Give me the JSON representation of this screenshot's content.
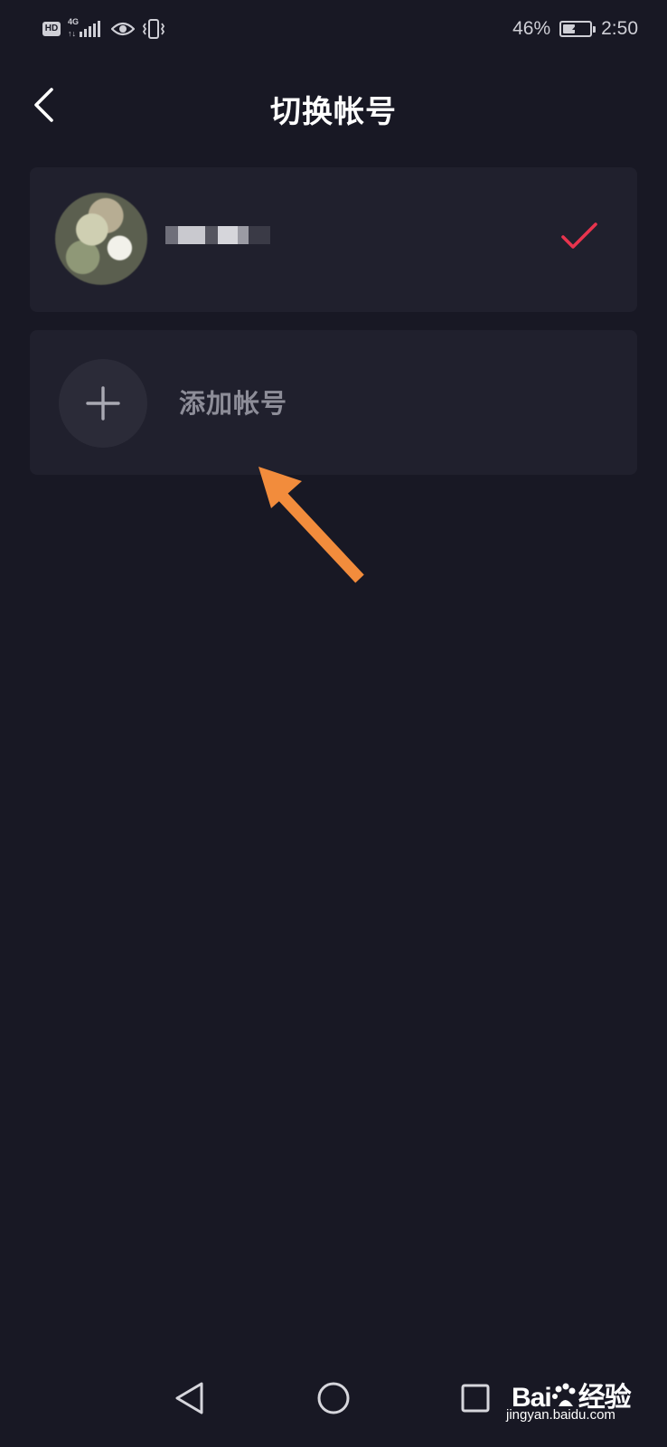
{
  "status_bar": {
    "hd": "HD",
    "network": "4G",
    "network_arrows": "↑↓",
    "battery_percent": "46%",
    "battery_level": 0.46,
    "time": "2:50"
  },
  "header": {
    "title": "切换帐号",
    "back_icon": "chevron-left-icon"
  },
  "accounts": {
    "current": {
      "selected": true,
      "check_color": "#e8344e"
    },
    "add": {
      "label": "添加帐号",
      "icon": "plus-icon"
    }
  },
  "annotation": {
    "arrow_color": "#f28c3c"
  },
  "nav_bar": {
    "back_icon": "triangle-back-icon",
    "home_icon": "circle-home-icon",
    "recent_icon": "square-recent-icon"
  },
  "watermark": {
    "logo_text": "Bai",
    "logo_text_2": "经验",
    "url": "jingyan.baidu.com"
  }
}
